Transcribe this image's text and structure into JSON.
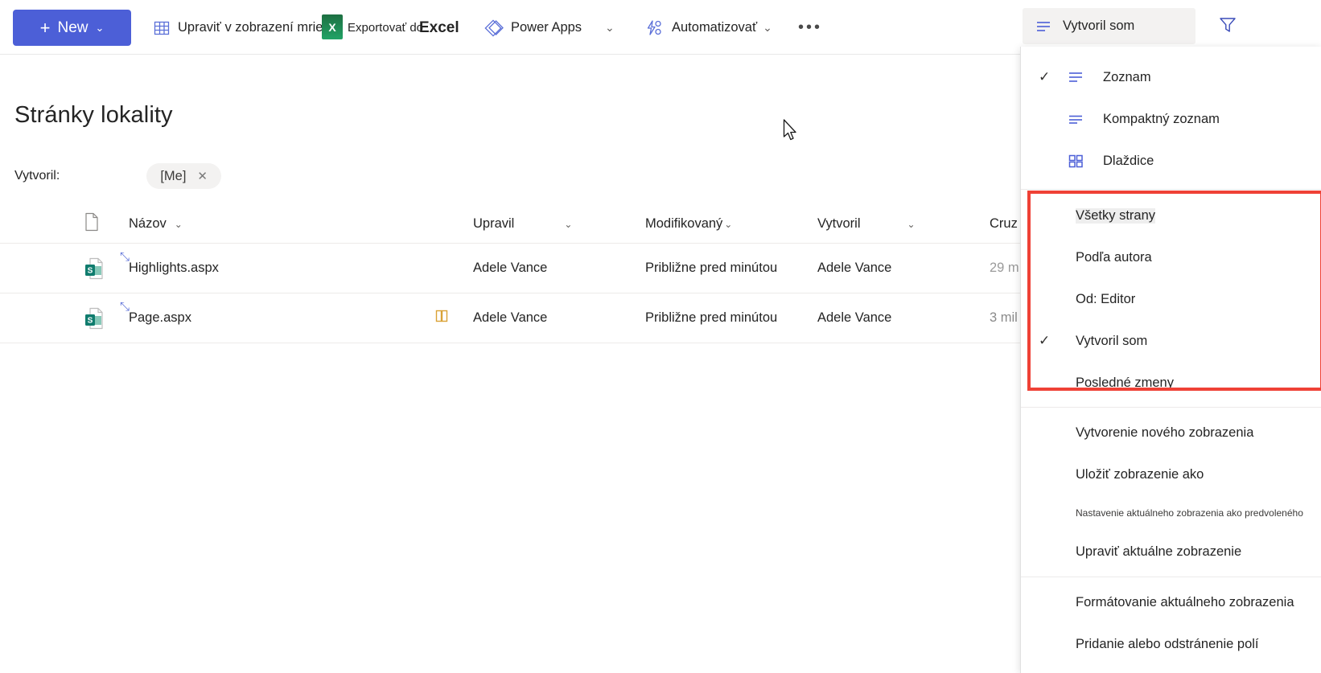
{
  "theme": {
    "accent": "#4c5fd7",
    "top_bar": "#2a3db0",
    "highlight_box": "#ef4136",
    "pill_bg": "#f3f2f1",
    "excel_green": "#21a366"
  },
  "command_bar": {
    "new_button": {
      "label": "New",
      "plus": "+",
      "chevron": "⌄",
      "icon": "plus-icon"
    },
    "items": [
      {
        "label": "Upraviť v zobrazení mriežky",
        "icon": "grid-view-icon"
      },
      {
        "label": "Exportovať do",
        "icon": "excel-icon",
        "secondary": "Excel"
      },
      {
        "label": "Power Apps",
        "icon": "power-apps-icon",
        "chevron": "⌄"
      },
      {
        "label": "Automatizovať",
        "icon": "power-automate-icon",
        "chevron": "⌄"
      },
      {
        "label": "•••",
        "icon": "more-icon"
      }
    ],
    "view_switch": {
      "label": "Vytvoril som",
      "icon": "list-view-icon"
    },
    "filter": {
      "icon": "filter-icon"
    }
  },
  "page": {
    "title": "Stránky lokality",
    "filter_label": "Vytvoril:",
    "filter_pill": {
      "value": "[Me]",
      "close": "✕"
    }
  },
  "table": {
    "columns": [
      {
        "key": "icon",
        "label": "",
        "icon": "file-type-icon",
        "sortable": false
      },
      {
        "key": "name",
        "label": "Názov",
        "chevron": "⌄",
        "sortable": true
      },
      {
        "key": "edited",
        "label": "Upravil",
        "chevron": "⌄",
        "sortable": true
      },
      {
        "key": "mod",
        "label": "Modifikovaný",
        "chevron": "⌄",
        "sortable": true
      },
      {
        "key": "created",
        "label": "Vytvoril",
        "chevron": "⌄",
        "sortable": true
      },
      {
        "key": "cruz",
        "label": "Cruz",
        "chevron": "",
        "sortable": true
      }
    ],
    "rows": [
      {
        "icon": "sharepoint-page-icon",
        "new_badge": true,
        "name": "Highlights.aspx",
        "flag": "",
        "edited": "Adele Vance",
        "mod": "Približne pred minútou",
        "created": "Adele Vance",
        "cruz": "29 m"
      },
      {
        "icon": "sharepoint-page-icon",
        "new_badge": true,
        "name": "Page.aspx",
        "flag": "book-icon",
        "edited": "Adele Vance",
        "mod": "Približne pred minútou",
        "created": "Adele Vance",
        "cruz": "3 mil"
      }
    ]
  },
  "view_menu": {
    "layout_group": [
      {
        "label": "Zoznam",
        "icon": "list-view-icon",
        "checked": true
      },
      {
        "label": "Kompaktný zoznam",
        "icon": "compact-list-icon",
        "checked": false
      },
      {
        "label": "Dlaždice",
        "icon": "tiles-icon",
        "checked": false
      }
    ],
    "views_group": [
      {
        "label": "Všetky strany",
        "checked": false,
        "highlighted": true
      },
      {
        "label": "Podľa autora",
        "checked": false,
        "highlighted": false
      },
      {
        "label": "Od: Editor",
        "checked": false,
        "highlighted": false
      },
      {
        "label": "Vytvoril som",
        "checked": true,
        "highlighted": false
      },
      {
        "label": "Posledné zmeny",
        "checked": false,
        "highlighted": false
      }
    ],
    "actions_group": [
      {
        "label": "Vytvorenie nového zobrazenia",
        "small": false
      },
      {
        "label": "Uložiť zobrazenie ako",
        "small": false
      },
      {
        "label": "Nastavenie aktuálneho zobrazenia ako predvoleného",
        "small": true
      },
      {
        "label": "Upraviť aktuálne zobrazenie",
        "small": false
      }
    ],
    "fields_group": [
      {
        "label": "Formátovanie aktuálneho zobrazenia",
        "small": false
      },
      {
        "label": "Pridanie alebo odstránenie polí",
        "small": false
      }
    ]
  }
}
